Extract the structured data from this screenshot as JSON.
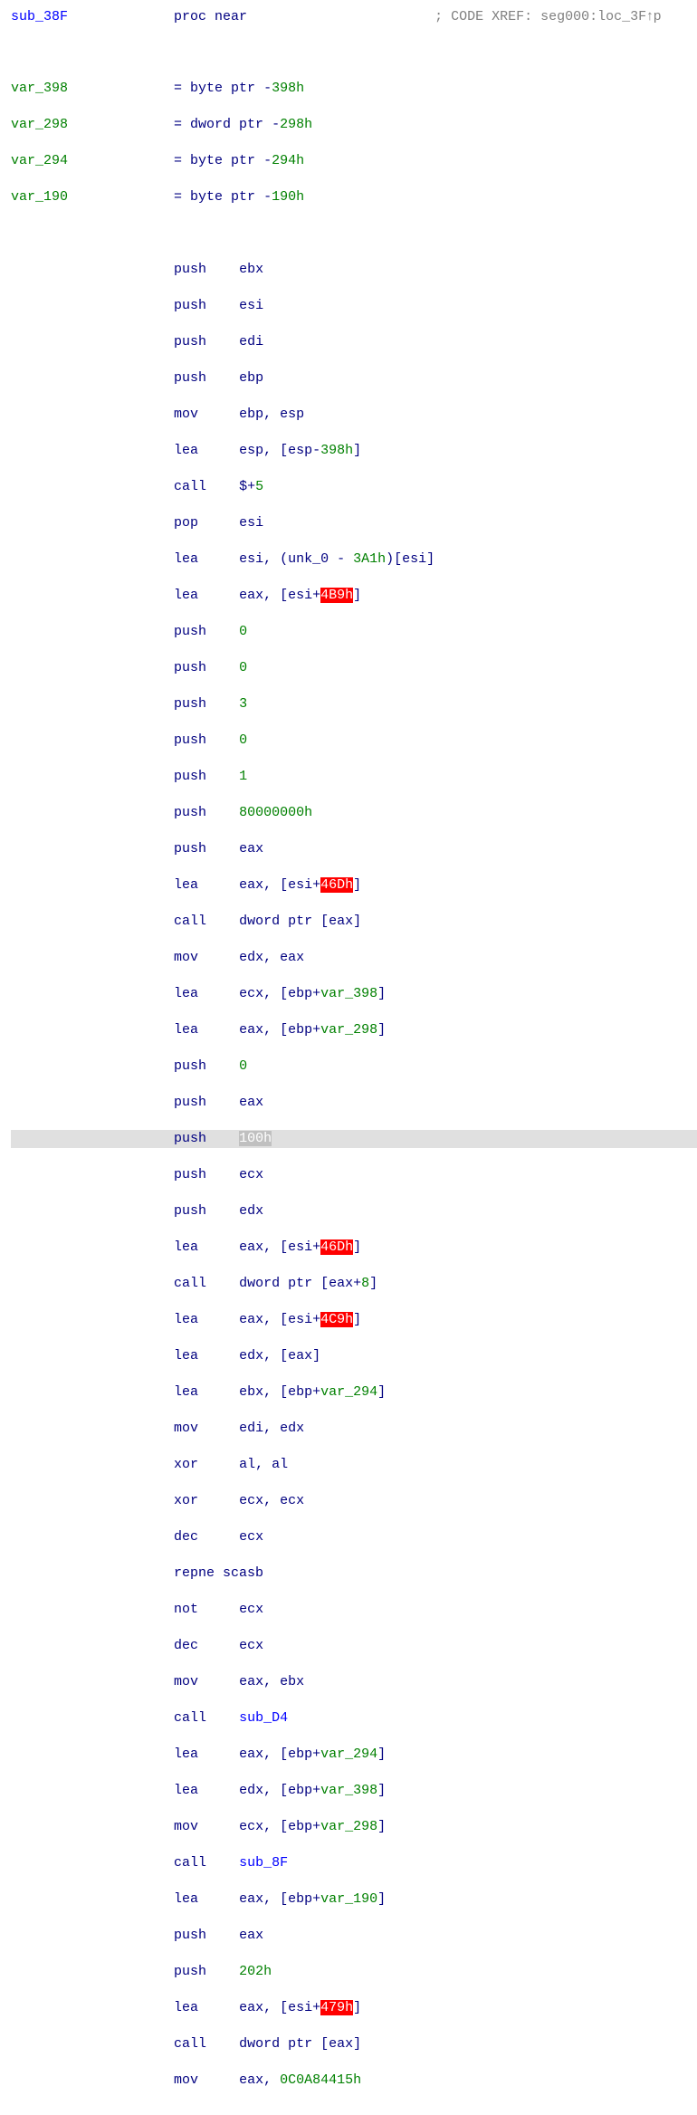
{
  "col_mnemonic_start": 20,
  "col_operand_start": 28,
  "col_comment_start": 52,
  "lines": [
    {
      "type": "header",
      "col": 0,
      "spans": [
        {
          "cls": "c-blue",
          "text": "sub_38F"
        }
      ],
      "mnemonic": {
        "cls": "c-navy",
        "text": "proc near"
      },
      "comment": {
        "cls": "c-gray",
        "text": "; CODE XREF: seg000:loc_3F↑p"
      }
    },
    {
      "type": "blank"
    },
    {
      "type": "vardecl",
      "col": 0,
      "name": {
        "cls": "c-green",
        "text": "var_398"
      },
      "equals": {
        "cls": "c-navy",
        "text": "= byte ptr -"
      },
      "off": {
        "cls": "c-green",
        "text": "398h"
      }
    },
    {
      "type": "vardecl",
      "col": 0,
      "name": {
        "cls": "c-green",
        "text": "var_298"
      },
      "equals": {
        "cls": "c-navy",
        "text": "= dword ptr -"
      },
      "off": {
        "cls": "c-green",
        "text": "298h"
      }
    },
    {
      "type": "vardecl",
      "col": 0,
      "name": {
        "cls": "c-green",
        "text": "var_294"
      },
      "equals": {
        "cls": "c-navy",
        "text": "= byte ptr -"
      },
      "off": {
        "cls": "c-green",
        "text": "294h"
      }
    },
    {
      "type": "vardecl",
      "col": 0,
      "name": {
        "cls": "c-green",
        "text": "var_190"
      },
      "equals": {
        "cls": "c-navy",
        "text": "= byte ptr -"
      },
      "off": {
        "cls": "c-green",
        "text": "190h"
      }
    },
    {
      "type": "blank"
    },
    {
      "type": "instr",
      "mnemonic": "push",
      "operands": [
        {
          "cls": "c-navy",
          "text": "ebx"
        }
      ]
    },
    {
      "type": "instr",
      "mnemonic": "push",
      "operands": [
        {
          "cls": "c-navy",
          "text": "esi"
        }
      ]
    },
    {
      "type": "instr",
      "mnemonic": "push",
      "operands": [
        {
          "cls": "c-navy",
          "text": "edi"
        }
      ]
    },
    {
      "type": "instr",
      "mnemonic": "push",
      "operands": [
        {
          "cls": "c-navy",
          "text": "ebp"
        }
      ]
    },
    {
      "type": "instr",
      "mnemonic": "mov",
      "operands": [
        {
          "cls": "c-navy",
          "text": "ebp, esp"
        }
      ]
    },
    {
      "type": "instr",
      "mnemonic": "lea",
      "operands": [
        {
          "cls": "c-navy",
          "text": "esp, [esp-"
        },
        {
          "cls": "c-green",
          "text": "398h"
        },
        {
          "cls": "c-navy",
          "text": "]"
        }
      ]
    },
    {
      "type": "instr",
      "mnemonic": "call",
      "operands": [
        {
          "cls": "c-navy",
          "text": "$+"
        },
        {
          "cls": "c-green",
          "text": "5"
        }
      ]
    },
    {
      "type": "instr",
      "mnemonic": "pop",
      "operands": [
        {
          "cls": "c-navy",
          "text": "esi"
        }
      ]
    },
    {
      "type": "instr",
      "mnemonic": "lea",
      "operands": [
        {
          "cls": "c-navy",
          "text": "esi, (unk_0 - "
        },
        {
          "cls": "c-green",
          "text": "3A1h"
        },
        {
          "cls": "c-navy",
          "text": ")[esi]"
        }
      ]
    },
    {
      "type": "instr",
      "mnemonic": "lea",
      "operands": [
        {
          "cls": "c-navy",
          "text": "eax, [esi+"
        },
        {
          "cls": "c-red",
          "text": "4B9h"
        },
        {
          "cls": "c-navy",
          "text": "]"
        }
      ]
    },
    {
      "type": "instr",
      "mnemonic": "push",
      "operands": [
        {
          "cls": "c-green",
          "text": "0"
        }
      ]
    },
    {
      "type": "instr",
      "mnemonic": "push",
      "operands": [
        {
          "cls": "c-green",
          "text": "0"
        }
      ]
    },
    {
      "type": "instr",
      "mnemonic": "push",
      "operands": [
        {
          "cls": "c-green",
          "text": "3"
        }
      ]
    },
    {
      "type": "instr",
      "mnemonic": "push",
      "operands": [
        {
          "cls": "c-green",
          "text": "0"
        }
      ]
    },
    {
      "type": "instr",
      "mnemonic": "push",
      "operands": [
        {
          "cls": "c-green",
          "text": "1"
        }
      ]
    },
    {
      "type": "instr",
      "mnemonic": "push",
      "operands": [
        {
          "cls": "c-green",
          "text": "80000000h"
        }
      ]
    },
    {
      "type": "instr",
      "mnemonic": "push",
      "operands": [
        {
          "cls": "c-navy",
          "text": "eax"
        }
      ]
    },
    {
      "type": "instr",
      "mnemonic": "lea",
      "operands": [
        {
          "cls": "c-navy",
          "text": "eax, [esi+"
        },
        {
          "cls": "c-red",
          "text": "46Dh"
        },
        {
          "cls": "c-navy",
          "text": "]"
        }
      ]
    },
    {
      "type": "instr",
      "mnemonic": "call",
      "operands": [
        {
          "cls": "c-navy",
          "text": "dword ptr [eax]"
        }
      ]
    },
    {
      "type": "instr",
      "mnemonic": "mov",
      "operands": [
        {
          "cls": "c-navy",
          "text": "edx, eax"
        }
      ]
    },
    {
      "type": "instr",
      "mnemonic": "lea",
      "operands": [
        {
          "cls": "c-navy",
          "text": "ecx, [ebp+"
        },
        {
          "cls": "c-green",
          "text": "var_398"
        },
        {
          "cls": "c-navy",
          "text": "]"
        }
      ]
    },
    {
      "type": "instr",
      "mnemonic": "lea",
      "operands": [
        {
          "cls": "c-navy",
          "text": "eax, [ebp+"
        },
        {
          "cls": "c-green",
          "text": "var_298"
        },
        {
          "cls": "c-navy",
          "text": "]"
        }
      ]
    },
    {
      "type": "instr",
      "mnemonic": "push",
      "operands": [
        {
          "cls": "c-green",
          "text": "0"
        }
      ]
    },
    {
      "type": "instr",
      "mnemonic": "push",
      "operands": [
        {
          "cls": "c-navy",
          "text": "eax"
        }
      ]
    },
    {
      "type": "instr",
      "hl": true,
      "mnemonic": "push",
      "operands": [
        {
          "cls": "c-selgray",
          "text": "100h"
        }
      ]
    },
    {
      "type": "instr",
      "mnemonic": "push",
      "operands": [
        {
          "cls": "c-navy",
          "text": "ecx"
        }
      ]
    },
    {
      "type": "instr",
      "mnemonic": "push",
      "operands": [
        {
          "cls": "c-navy",
          "text": "edx"
        }
      ]
    },
    {
      "type": "instr",
      "mnemonic": "lea",
      "operands": [
        {
          "cls": "c-navy",
          "text": "eax, [esi+"
        },
        {
          "cls": "c-red",
          "text": "46Dh"
        },
        {
          "cls": "c-navy",
          "text": "]"
        }
      ]
    },
    {
      "type": "instr",
      "mnemonic": "call",
      "operands": [
        {
          "cls": "c-navy",
          "text": "dword ptr [eax+"
        },
        {
          "cls": "c-green",
          "text": "8"
        },
        {
          "cls": "c-navy",
          "text": "]"
        }
      ]
    },
    {
      "type": "instr",
      "mnemonic": "lea",
      "operands": [
        {
          "cls": "c-navy",
          "text": "eax, [esi+"
        },
        {
          "cls": "c-red",
          "text": "4C9h"
        },
        {
          "cls": "c-navy",
          "text": "]"
        }
      ]
    },
    {
      "type": "instr",
      "mnemonic": "lea",
      "operands": [
        {
          "cls": "c-navy",
          "text": "edx, [eax]"
        }
      ]
    },
    {
      "type": "instr",
      "mnemonic": "lea",
      "operands": [
        {
          "cls": "c-navy",
          "text": "ebx, [ebp+"
        },
        {
          "cls": "c-green",
          "text": "var_294"
        },
        {
          "cls": "c-navy",
          "text": "]"
        }
      ]
    },
    {
      "type": "instr",
      "mnemonic": "mov",
      "operands": [
        {
          "cls": "c-navy",
          "text": "edi, edx"
        }
      ]
    },
    {
      "type": "instr",
      "mnemonic": "xor",
      "operands": [
        {
          "cls": "c-navy",
          "text": "al, al"
        }
      ]
    },
    {
      "type": "instr",
      "mnemonic": "xor",
      "operands": [
        {
          "cls": "c-navy",
          "text": "ecx, ecx"
        }
      ]
    },
    {
      "type": "instr",
      "mnemonic": "dec",
      "operands": [
        {
          "cls": "c-navy",
          "text": "ecx"
        }
      ]
    },
    {
      "type": "instr_raw",
      "raw": [
        {
          "cls": "c-navy",
          "text": "repne scasb"
        }
      ]
    },
    {
      "type": "instr",
      "mnemonic": "not",
      "operands": [
        {
          "cls": "c-navy",
          "text": "ecx"
        }
      ]
    },
    {
      "type": "instr",
      "mnemonic": "dec",
      "operands": [
        {
          "cls": "c-navy",
          "text": "ecx"
        }
      ]
    },
    {
      "type": "instr",
      "mnemonic": "mov",
      "operands": [
        {
          "cls": "c-navy",
          "text": "eax, ebx"
        }
      ]
    },
    {
      "type": "instr",
      "mnemonic": "call",
      "operands": [
        {
          "cls": "c-blue",
          "text": "sub_D4"
        }
      ]
    },
    {
      "type": "instr",
      "mnemonic": "lea",
      "operands": [
        {
          "cls": "c-navy",
          "text": "eax, [ebp+"
        },
        {
          "cls": "c-green",
          "text": "var_294"
        },
        {
          "cls": "c-navy",
          "text": "]"
        }
      ]
    },
    {
      "type": "instr",
      "mnemonic": "lea",
      "operands": [
        {
          "cls": "c-navy",
          "text": "edx, [ebp+"
        },
        {
          "cls": "c-green",
          "text": "var_398"
        },
        {
          "cls": "c-navy",
          "text": "]"
        }
      ]
    },
    {
      "type": "instr",
      "mnemonic": "mov",
      "operands": [
        {
          "cls": "c-navy",
          "text": "ecx, [ebp+"
        },
        {
          "cls": "c-green",
          "text": "var_298"
        },
        {
          "cls": "c-navy",
          "text": "]"
        }
      ]
    },
    {
      "type": "instr",
      "mnemonic": "call",
      "operands": [
        {
          "cls": "c-blue",
          "text": "sub_8F"
        }
      ]
    },
    {
      "type": "instr",
      "mnemonic": "lea",
      "operands": [
        {
          "cls": "c-navy",
          "text": "eax, [ebp+"
        },
        {
          "cls": "c-green",
          "text": "var_190"
        },
        {
          "cls": "c-navy",
          "text": "]"
        }
      ]
    },
    {
      "type": "instr",
      "mnemonic": "push",
      "operands": [
        {
          "cls": "c-navy",
          "text": "eax"
        }
      ]
    },
    {
      "type": "instr",
      "mnemonic": "push",
      "operands": [
        {
          "cls": "c-green",
          "text": "202h"
        }
      ]
    },
    {
      "type": "instr",
      "mnemonic": "lea",
      "operands": [
        {
          "cls": "c-navy",
          "text": "eax, [esi+"
        },
        {
          "cls": "c-red",
          "text": "479h"
        },
        {
          "cls": "c-navy",
          "text": "]"
        }
      ]
    },
    {
      "type": "instr",
      "mnemonic": "call",
      "operands": [
        {
          "cls": "c-navy",
          "text": "dword ptr [eax]"
        }
      ]
    },
    {
      "type": "instr",
      "mnemonic": "mov",
      "operands": [
        {
          "cls": "c-navy",
          "text": "eax, "
        },
        {
          "cls": "c-green",
          "text": "0C0A84415h"
        }
      ]
    }
  ]
}
